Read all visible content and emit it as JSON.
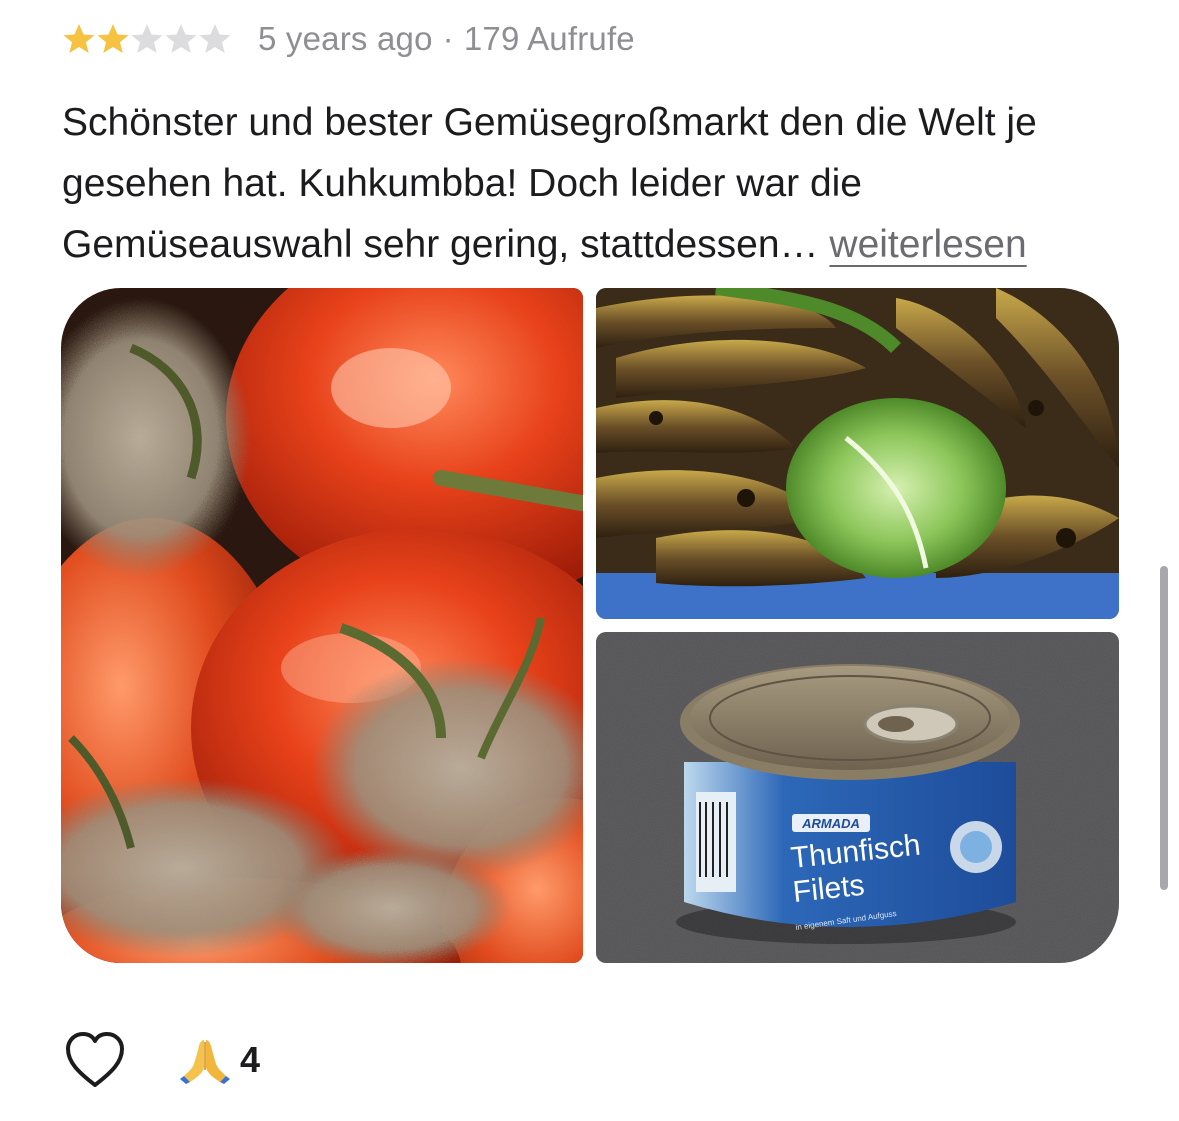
{
  "review": {
    "rating": 2,
    "rating_max": 5,
    "star_color_filled": "#f5c242",
    "star_color_empty": "#dcdcdf",
    "age": "5 years ago",
    "separator": "·",
    "views": "179 Aufrufe",
    "text": "Schönster und bester Gemüsegroßmarkt den die Welt je gesehen hat. Kuhkumbba! Doch leider war die Gemüseauswahl sehr gering, stattdessen… ",
    "read_more_label": "weiterlesen"
  },
  "photos": {
    "left": {
      "depicts": "moldy-tomatoes"
    },
    "top_right": {
      "depicts": "rotten-bananas-and-lettuce"
    },
    "bottom_right": {
      "depicts": "tuna-can",
      "brand": "ARMADA",
      "product_line1": "Thunfisch",
      "product_line2": "Filets",
      "small_print": "in eigenem Saft und Aufguss"
    }
  },
  "actions": {
    "like_icon": "heart-outline-icon",
    "reaction_icon": "folded-hands-emoji",
    "reaction_count": "4"
  }
}
